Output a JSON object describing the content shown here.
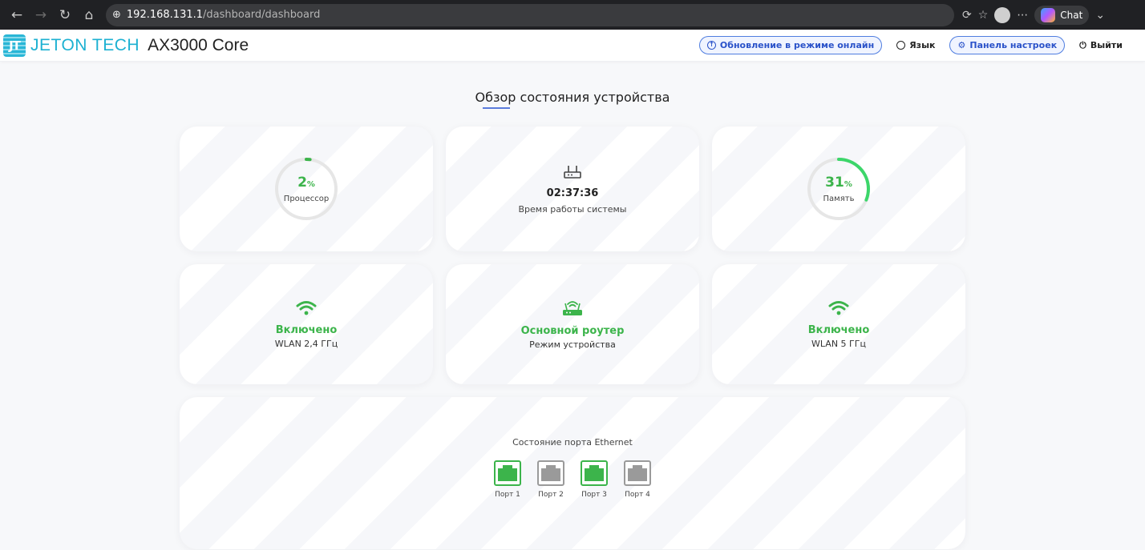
{
  "browser": {
    "url_host": "192.168.131.1",
    "url_path": "/dashboard/dashboard",
    "chat_label": "Chat"
  },
  "header": {
    "brand": "JETON TECH",
    "model": "AX3000 Core",
    "logo_text": "JT",
    "online_update": "Обновление в режиме онлайн",
    "language": "Язык",
    "settings_panel": "Панель настроек",
    "logout": "Выйти"
  },
  "page": {
    "title": "Обзор состояния устройства"
  },
  "cards": {
    "cpu": {
      "value": "2",
      "unit": "%",
      "label": "Процессор",
      "fraction": 0.02
    },
    "uptime": {
      "value": "02:37:36",
      "label": "Время работы системы",
      "icon": "router-icon"
    },
    "memory": {
      "value": "31",
      "unit": "%",
      "label": "Память",
      "fraction": 0.31
    },
    "wlan24": {
      "status": "Включено",
      "label": "WLAN 2,4 ГГц",
      "icon": "wifi-icon"
    },
    "mode": {
      "status": "Основной роутер",
      "label": "Режим устройства",
      "icon": "wireless-router-icon"
    },
    "wlan5": {
      "status": "Включено",
      "label": "WLAN 5 ГГц",
      "icon": "wifi-icon"
    }
  },
  "ethernet": {
    "title": "Состояние порта Ethernet",
    "ports": [
      {
        "label": "Порт 1",
        "up": true
      },
      {
        "label": "Порт 2",
        "up": false
      },
      {
        "label": "Порт 3",
        "up": true
      },
      {
        "label": "Порт 4",
        "up": false
      }
    ]
  },
  "colors": {
    "accent_green": "#3cb44b",
    "accent_blue": "#2a52c9",
    "brand_cyan": "#1db1d2",
    "port_down": "#9a9a9a"
  }
}
